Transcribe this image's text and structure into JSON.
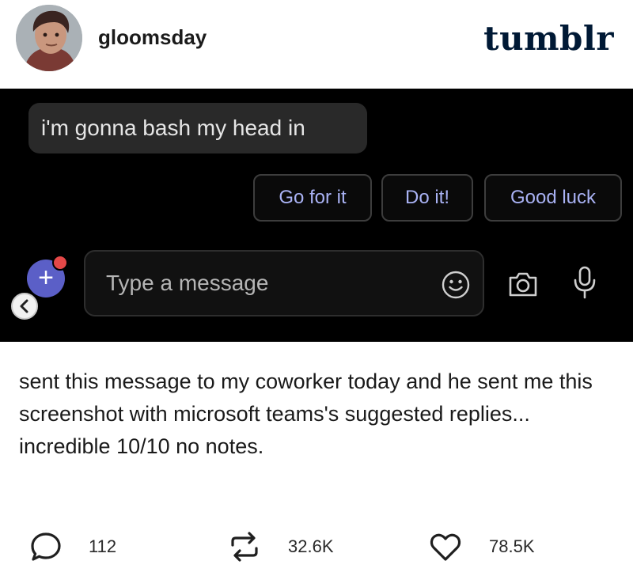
{
  "post": {
    "username": "gloomsday",
    "brand": "tumblr",
    "caption": "sent this message to my coworker today and he sent me this screenshot with microsoft teams's suggested replies... incredible 10/10 no notes."
  },
  "screenshot": {
    "message": "i'm gonna bash my head in",
    "suggested_replies": [
      "Go for it",
      "Do it!",
      "Good luck"
    ],
    "compose_placeholder": "Type a message",
    "icons": [
      "plus-icon",
      "back-chevron-icon",
      "emoji-icon",
      "camera-icon",
      "microphone-icon"
    ]
  },
  "footer": {
    "replies": "112",
    "reblogs": "32.6K",
    "likes": "78.5K"
  },
  "colors": {
    "accent": "#5b5fc7",
    "suggestion_text": "#a9b2f4",
    "notification_dot": "#e44848",
    "brand": "#001935"
  }
}
